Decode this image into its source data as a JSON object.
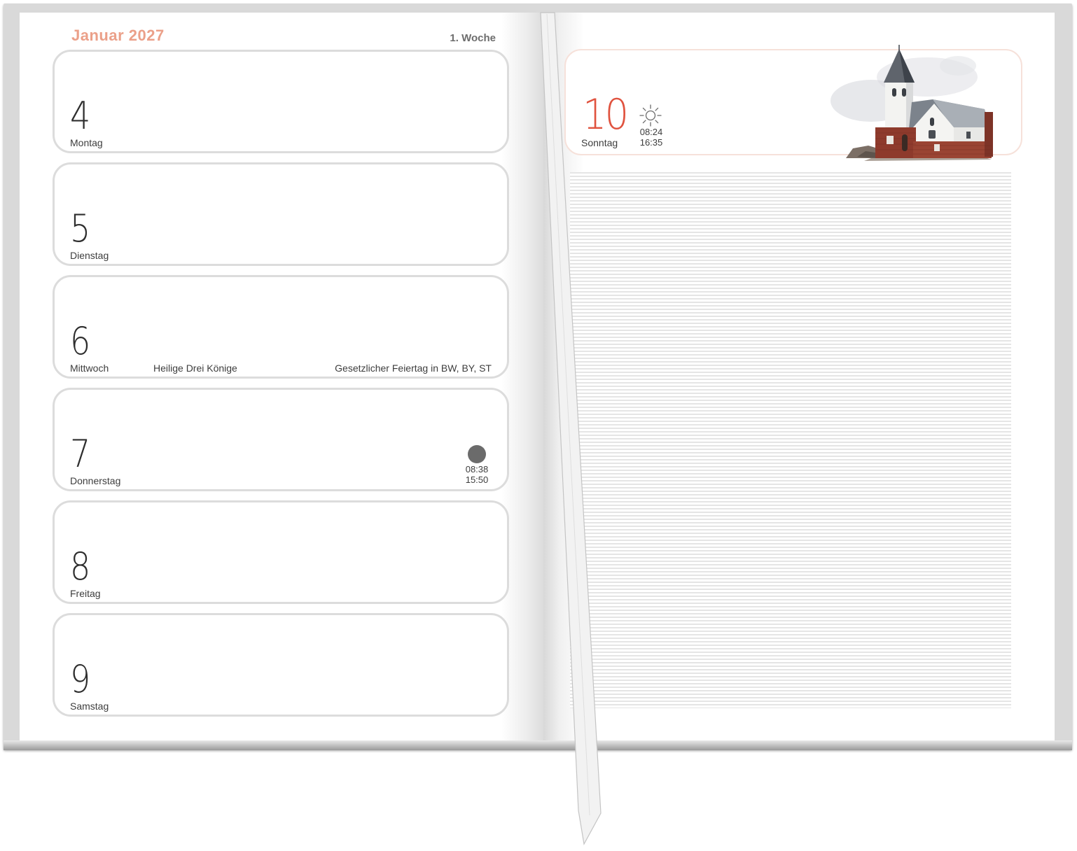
{
  "header": {
    "month": "Januar 2027",
    "week": "1. Woche"
  },
  "days": [
    {
      "num": "4",
      "name": "Montag"
    },
    {
      "num": "5",
      "name": "Dienstag"
    },
    {
      "num": "6",
      "name": "Mittwoch",
      "holiday": "Heilige Drei Könige",
      "note": "Gesetzlicher Feiertag in BW, BY, ST"
    },
    {
      "num": "7",
      "name": "Donnerstag",
      "moon_icon": "full-moon-icon",
      "moon_rise": "08:38",
      "moon_set": "15:50"
    },
    {
      "num": "8",
      "name": "Freitag"
    },
    {
      "num": "9",
      "name": "Samstag"
    }
  ],
  "sunday": {
    "num": "10",
    "name": "Sonntag",
    "sun_icon": "sun-icon",
    "sunrise": "08:24",
    "sunset": "16:35",
    "illustration": "church-watercolor-illustration"
  },
  "colors": {
    "month_title": "#eba089",
    "sunday_number": "#e0533f",
    "box_border": "#dcdcdc",
    "sunday_border": "#f6e1da",
    "ruled_line": "#e5e5e5"
  }
}
